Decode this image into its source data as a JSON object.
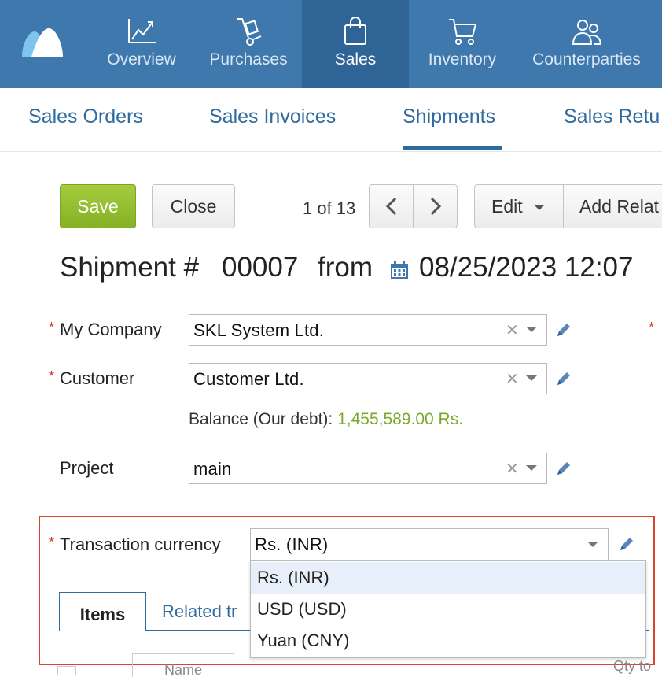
{
  "topnav": {
    "items": [
      {
        "label": "Overview",
        "icon": "chart-line-icon"
      },
      {
        "label": "Purchases",
        "icon": "hand-truck-icon"
      },
      {
        "label": "Sales",
        "icon": "shopping-bag-icon",
        "active": true
      },
      {
        "label": "Inventory",
        "icon": "cart-icon"
      },
      {
        "label": "Counterparties",
        "icon": "people-icon"
      }
    ]
  },
  "subnav": {
    "tabs": [
      {
        "label": "Sales Orders"
      },
      {
        "label": "Sales Invoices"
      },
      {
        "label": "Shipments",
        "active": true
      },
      {
        "label": "Sales Retu"
      }
    ]
  },
  "toolbar": {
    "save": "Save",
    "close": "Close",
    "pager": "1 of 13",
    "edit": "Edit",
    "add_related": "Add Relat"
  },
  "doc": {
    "prefix": "Shipment #",
    "number": "00007",
    "from": "from",
    "datetime": "08/25/2023 12:07"
  },
  "fields": {
    "company": {
      "label": "My Company",
      "value": "SKL System Ltd.",
      "required": "*"
    },
    "customer": {
      "label": "Customer",
      "value": "Customer Ltd.",
      "required": "*"
    },
    "balance": {
      "label": "Balance (Our debt):",
      "amount": "1,455,589.00 Rs."
    },
    "project": {
      "label": "Project",
      "value": "main"
    },
    "currency": {
      "label": "Transaction currency",
      "value": "Rs. (INR)",
      "required": "*"
    }
  },
  "tabs": {
    "items": "Items",
    "related": "Related tr"
  },
  "currency_options": [
    "Rs. (INR)",
    "USD (USD)",
    "Yuan (CNY)"
  ],
  "table": {
    "name_header": "Name",
    "qty_header": "Qty to"
  },
  "colors": {
    "topbar": "#3f78ad",
    "active_nav": "#2f6496",
    "accent": "#2f6b9f",
    "save": "#8cb82c",
    "highlight": "#d9442b",
    "balance": "#7aa82b"
  }
}
